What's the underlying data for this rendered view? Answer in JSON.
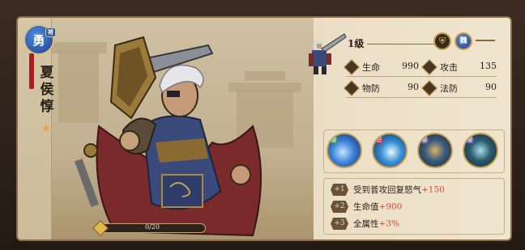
{
  "hero": {
    "name": "夏侯惇",
    "badge_main": "勇",
    "badge_sub": "将",
    "star_count": 1,
    "level_label": "1级",
    "faction": "魏",
    "fragments": "0/20",
    "fragments_fraction": 0
  },
  "stats": [
    {
      "label": "生命",
      "value": "990"
    },
    {
      "label": "攻击",
      "value": "135"
    },
    {
      "label": "物防",
      "value": "90"
    },
    {
      "label": "法防",
      "value": "90"
    }
  ],
  "skills": [
    {
      "tag": "普",
      "tag_color": "#3f9a5a",
      "icon": "water-wave-icon"
    },
    {
      "tag": "怒",
      "tag_color": "#b0334a",
      "icon": "water-burst-icon"
    },
    {
      "tag": "被",
      "tag_color": "#7a5a9a",
      "icon": "crossed-swords-icon"
    },
    {
      "tag": "被",
      "tag_color": "#6a58a8",
      "icon": "crossed-blades-icon"
    }
  ],
  "buffs": [
    {
      "num": "+1",
      "text": "受到普攻回复怒气",
      "value": "+150"
    },
    {
      "num": "+2",
      "text": "生命值",
      "value": "+900"
    },
    {
      "num": "+3",
      "text": "全属性",
      "value": "+3%"
    }
  ],
  "colors": {
    "accent_red": "#e0452f",
    "gold": "#c9a14e",
    "panel": "#efe4cd"
  }
}
